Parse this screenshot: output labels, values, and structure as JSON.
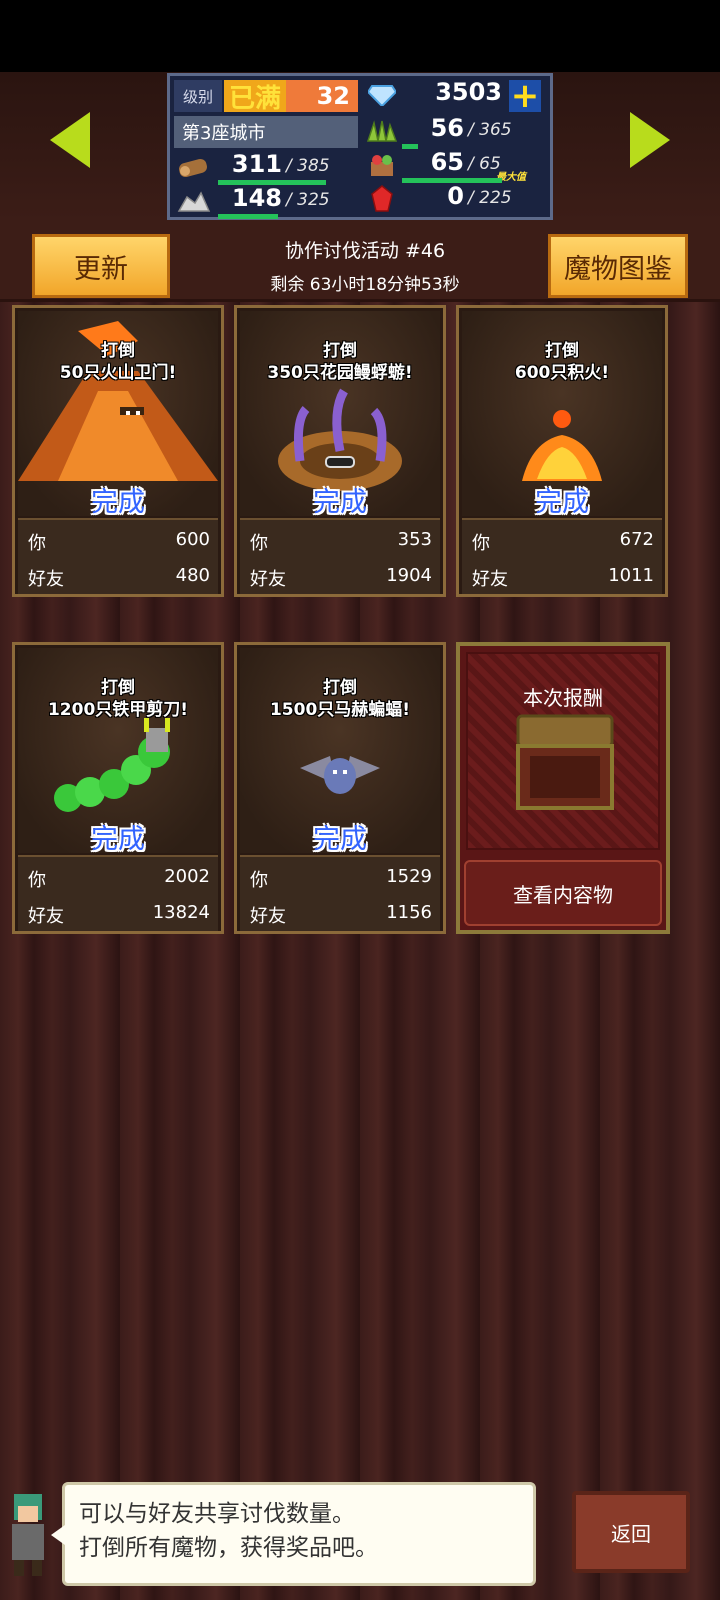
{
  "status": {
    "level_label": "级别",
    "level_badge": "已满",
    "level_value": "32",
    "city": "第3座城市",
    "gems": "3503",
    "resources": [
      {
        "name": "wood",
        "icon": "wood-log-icon",
        "value": "311",
        "max": "385",
        "fill": 0.81
      },
      {
        "name": "stone",
        "icon": "stone-pile-icon",
        "value": "148",
        "max": "325",
        "fill": 0.46
      },
      {
        "name": "grass",
        "icon": "grass-icon",
        "value": "56",
        "max": "365",
        "fill": 0.15
      },
      {
        "name": "food",
        "icon": "food-basket-icon",
        "value": "65",
        "max": "65",
        "fill": 1.0,
        "tag": "最大值"
      },
      {
        "name": "ruby",
        "icon": "ruby-gem-icon",
        "value": "0",
        "max": "225",
        "fill": 0.0
      }
    ]
  },
  "event": {
    "refresh_label": "更新",
    "bestiary_label": "魔物图鉴",
    "title": "协作讨伐活动 #46",
    "remaining": "剩余 63小时18分钟53秒"
  },
  "labels": {
    "you": "你",
    "friend": "好友",
    "done": "完成"
  },
  "tasks": [
    {
      "line1": "打倒",
      "line2": "50只火山卫门!",
      "you": "600",
      "friend": "480",
      "monster": "volcano-monster-icon"
    },
    {
      "line1": "打倒",
      "line2": "350只花园鳗蜉蝣!",
      "you": "353",
      "friend": "1904",
      "monster": "garden-eel-monster-icon"
    },
    {
      "line1": "打倒",
      "line2": "600只积火!",
      "you": "672",
      "friend": "1011",
      "monster": "fire-blob-monster-icon"
    },
    {
      "line1": "打倒",
      "line2": "1200只铁甲剪刀!",
      "you": "2002",
      "friend": "13824",
      "monster": "caterpillar-monster-icon"
    },
    {
      "line1": "打倒",
      "line2": "1500只马赫蝙蝠!",
      "you": "1529",
      "friend": "1156",
      "monster": "bat-monster-icon"
    }
  ],
  "reward": {
    "title": "本次报酬",
    "view_label": "查看内容物"
  },
  "hint": {
    "line1": "可以与好友共享讨伐数量。",
    "line2": "打倒所有魔物，获得奖品吧。"
  },
  "back_label": "返回",
  "colors": {
    "accent_yellow": "#f2a62a",
    "done_blue": "#3264ff",
    "bar_green": "#24c25a",
    "panel_navy": "#1a2340"
  }
}
